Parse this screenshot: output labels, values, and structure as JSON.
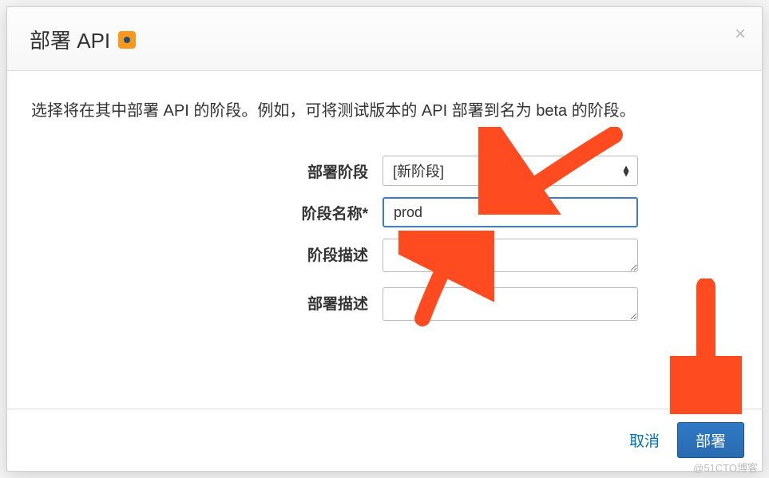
{
  "modal": {
    "title": "部署 API",
    "close_symbol": "×",
    "intro": "选择将在其中部署 API 的阶段。例如，可将测试版本的 API 部署到名为 beta 的阶段。"
  },
  "form": {
    "stage_label": "部署阶段",
    "stage_select_value": "[新阶段]",
    "name_label": "阶段名称*",
    "name_value": "prod",
    "stage_desc_label": "阶段描述",
    "stage_desc_value": "",
    "deploy_desc_label": "部署描述",
    "deploy_desc_value": ""
  },
  "footer": {
    "cancel_label": "取消",
    "deploy_label": "部署"
  },
  "annotations": {
    "arrow_color": "#ff4b1f"
  },
  "watermark": "@51CTO博客"
}
